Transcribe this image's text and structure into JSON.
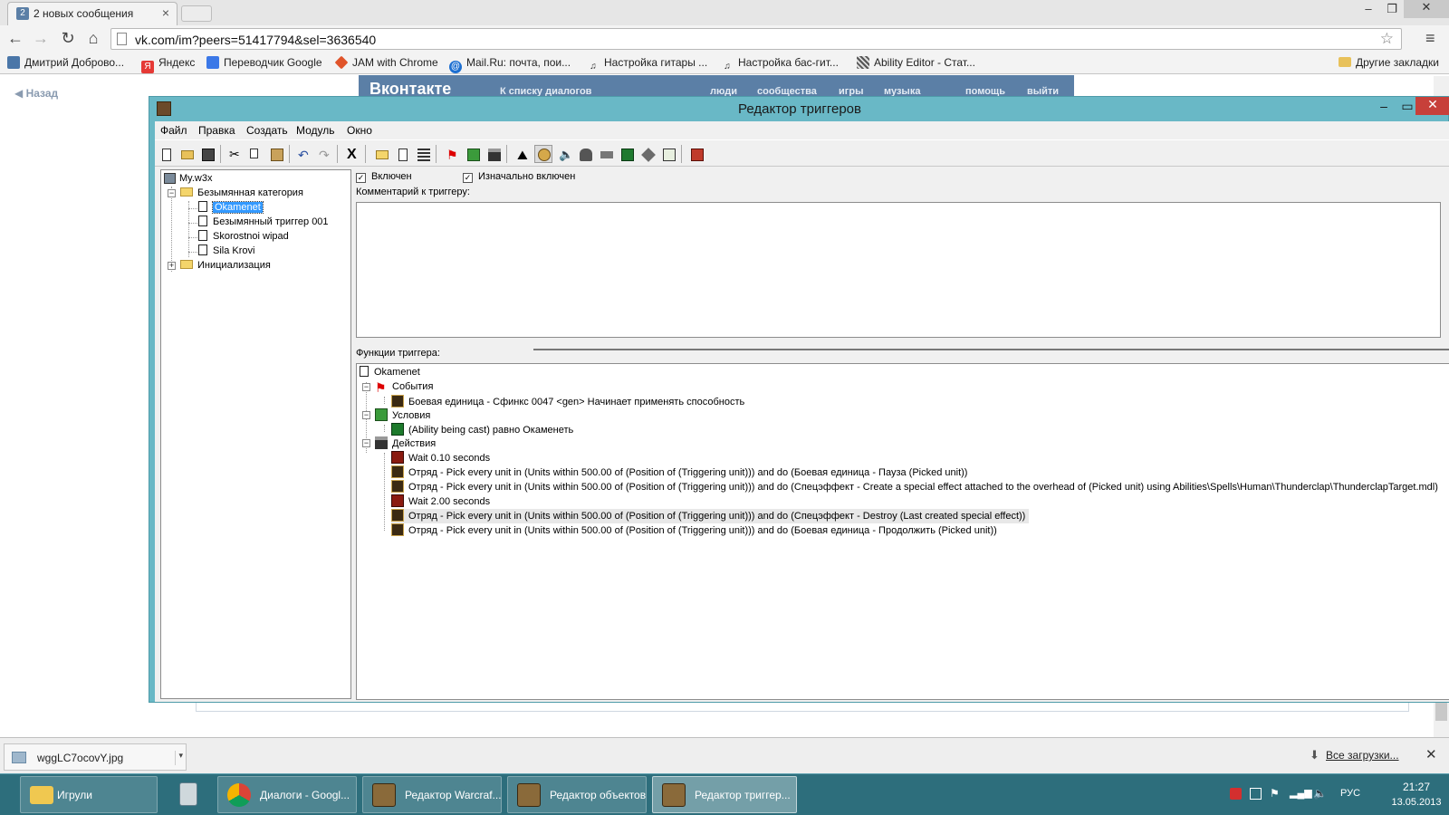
{
  "browser": {
    "tab_title": "2 новых сообщения",
    "tab_favicon": "2",
    "url": "vk.com/im?peers=51417794&sel=3636540",
    "bookmarks": [
      {
        "label": "Дмитрий Доброво...",
        "icon": "vk-user-icon",
        "color": "#4a76a8"
      },
      {
        "label": "Яндекс",
        "icon": "yandex-icon",
        "color": "#e53935"
      },
      {
        "label": "Переводчик Google",
        "icon": "google-translate-icon",
        "color": "#3b78e7"
      },
      {
        "label": "JAM with Chrome",
        "icon": "jam-icon",
        "color": "#e0542a"
      },
      {
        "label": "Mail.Ru: почта, пои...",
        "icon": "mailru-icon",
        "color": "#1d6fd1"
      },
      {
        "label": "Настройка гитары ...",
        "icon": "music-note-icon",
        "color": "#222222"
      },
      {
        "label": "Настройка бас-гит...",
        "icon": "music-note-icon",
        "color": "#222222"
      },
      {
        "label": "Ability Editor - Стат...",
        "icon": "ability-editor-icon",
        "color": "#555555"
      },
      {
        "label": "Другие закладки",
        "icon": "folder-icon",
        "color": "#e8c15a"
      }
    ]
  },
  "vk_page": {
    "back_label": "Назад",
    "logo": "Вконтакте",
    "dialogs_link": "К списку диалогов",
    "nav": [
      "люди",
      "сообщества",
      "игры",
      "музыка",
      "помощь",
      "выйти"
    ]
  },
  "editor": {
    "title": "Редактор триггеров",
    "menu": [
      "Файл",
      "Правка",
      "Создать",
      "Модуль",
      "Окно"
    ],
    "tree": {
      "root": "My.w3x",
      "category": "Безымянная категория",
      "triggers": [
        "Okamenet",
        "Безымянный триггер 001",
        "Skorostnoi wipad",
        "Sila Krovi"
      ],
      "selected": "Okamenet",
      "init_folder": "Инициализация"
    },
    "enabled_label": "Включен",
    "initially_enabled_label": "Изначально включен",
    "comment_label": "Комментарий к триггеру:",
    "functions_label": "Функции триггера:",
    "functions": {
      "trigger_name": "Okamenet",
      "events_label": "События",
      "events": [
        "Боевая единица - Сфинкс 0047 <gen> Начинает применять способность"
      ],
      "conditions_label": "Условия",
      "conditions": [
        "(Ability being cast) равно Окаменеть"
      ],
      "actions_label": "Действия",
      "actions": [
        "Wait 0.10 seconds",
        "Отряд - Pick every unit in (Units within 500.00 of (Position of (Triggering unit))) and do (Боевая единица - Пауза (Picked unit))",
        "Отряд - Pick every unit in (Units within 500.00 of (Position of (Triggering unit))) and do (Спецэффект - Create a special effect attached to the overhead of (Picked unit) using Abilities\\Spells\\Human\\Thunderclap\\ThunderclapTarget.mdl)",
        "Wait 2.00 seconds",
        "Отряд - Pick every unit in (Units within 500.00 of (Position of (Triggering unit))) and do (Спецэффект - Destroy (Last created special effect))",
        "Отряд - Pick every unit in (Units within 500.00 of (Position of (Triggering unit))) and do (Боевая единица - Продолжить (Picked unit))"
      ]
    }
  },
  "downloads": {
    "file": "wggLC7ocovY.jpg",
    "all_label": "Все загрузки..."
  },
  "taskbar": {
    "buttons": [
      {
        "label": "Игрули",
        "icon": "folder-icon"
      },
      {
        "label": "",
        "icon": "calculator-icon"
      },
      {
        "label": "Диалоги - Googl...",
        "icon": "chrome-icon"
      },
      {
        "label": "Редактор Warcraf...",
        "icon": "warcraft-editor-icon"
      },
      {
        "label": "Редактор объектов",
        "icon": "object-editor-icon"
      },
      {
        "label": "Редактор триггер...",
        "icon": "trigger-editor-icon"
      }
    ],
    "language": "РУС",
    "time": "21:27",
    "date": "13.05.2013"
  }
}
